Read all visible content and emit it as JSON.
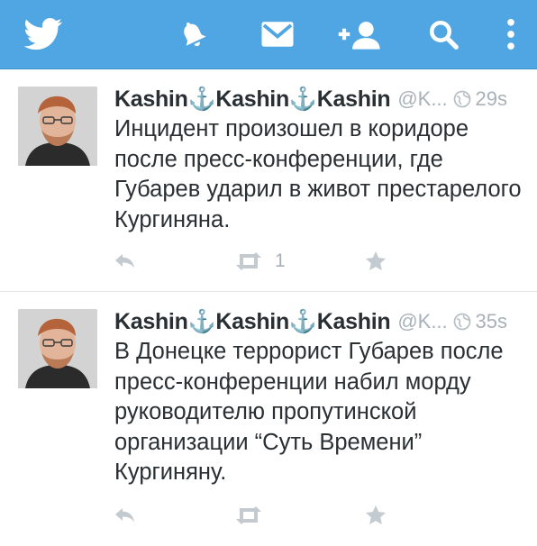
{
  "topbar": {
    "color": "#4fa6e3",
    "icons": [
      "twitter-bird-icon",
      "bell-icon",
      "envelope-icon",
      "add-user-icon",
      "search-icon",
      "overflow-menu-icon"
    ]
  },
  "tweets": [
    {
      "name": "Kashin⚓Kashin⚓Kashin",
      "handle": "@K...",
      "time": "29s",
      "text": "Инцидент произошел в коридоре после пресс-конференции, где Губарев ударил в живот престарелого Кургиняна.",
      "retweet_count": "1"
    },
    {
      "name": "Kashin⚓Kashin⚓Kashin",
      "handle": "@K...",
      "time": "35s",
      "text": "В Донецке террорист Губарев после пресс-конференции набил морду руководителю пропутинской организации “Суть Времени” Кургиняну.",
      "retweet_count": ""
    }
  ]
}
